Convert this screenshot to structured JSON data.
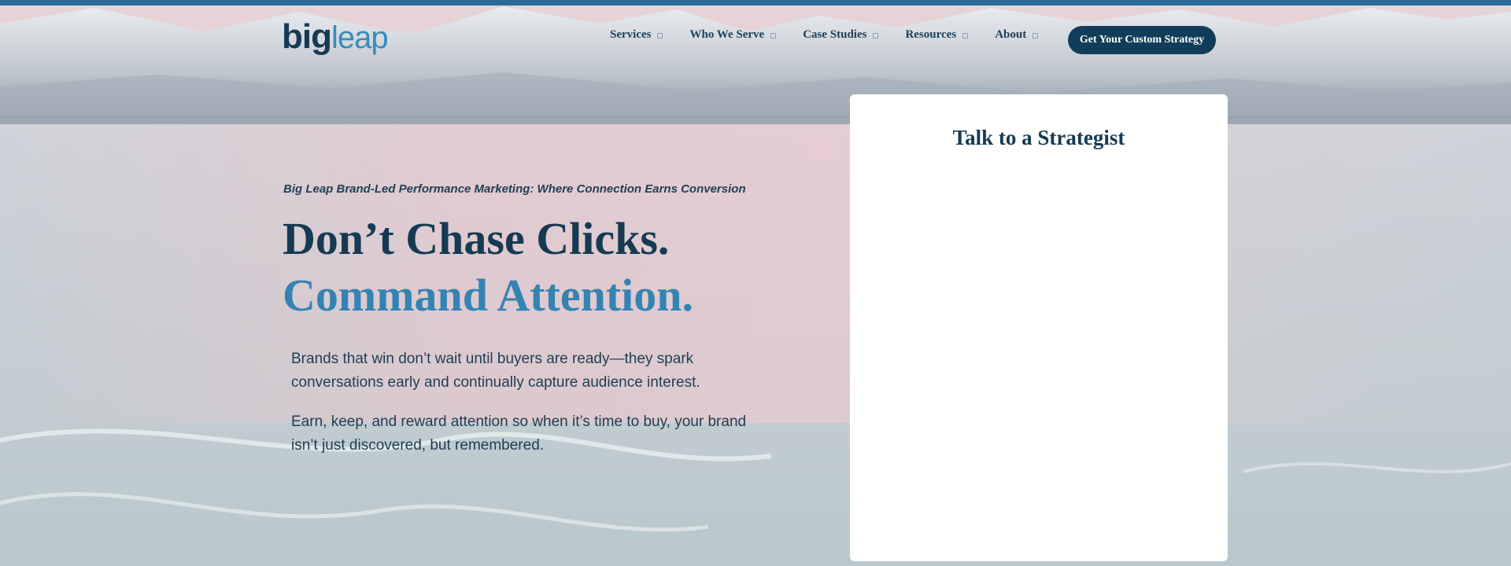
{
  "header": {
    "logo": {
      "part1": "big",
      "part2": "leap"
    },
    "nav": [
      {
        "label": "Services"
      },
      {
        "label": "Who We Serve"
      },
      {
        "label": "Case Studies"
      },
      {
        "label": "Resources"
      },
      {
        "label": "About"
      }
    ],
    "cta_label": "Get Your Custom Strategy"
  },
  "hero": {
    "eyebrow": "Big Leap Brand-Led Performance Marketing: Where Connection Earns Conversion",
    "headline_line1": "Don’t Chase Clicks.",
    "headline_line2": "Command Attention.",
    "paragraph1": "Brands that win don’t wait until buyers are ready—they spark conversations early and continually capture audience interest.",
    "paragraph2": "Earn, keep, and reward attention so when it’s time to buy, your brand isn’t just discovered, but remembered."
  },
  "form_card": {
    "title": "Talk to a Strategist"
  },
  "colors": {
    "brand_dark": "#163a52",
    "brand_accent": "#3483b2",
    "top_bar": "#2c6b95"
  },
  "icons": {
    "nav_dropdown": "chevron-down-icon"
  }
}
